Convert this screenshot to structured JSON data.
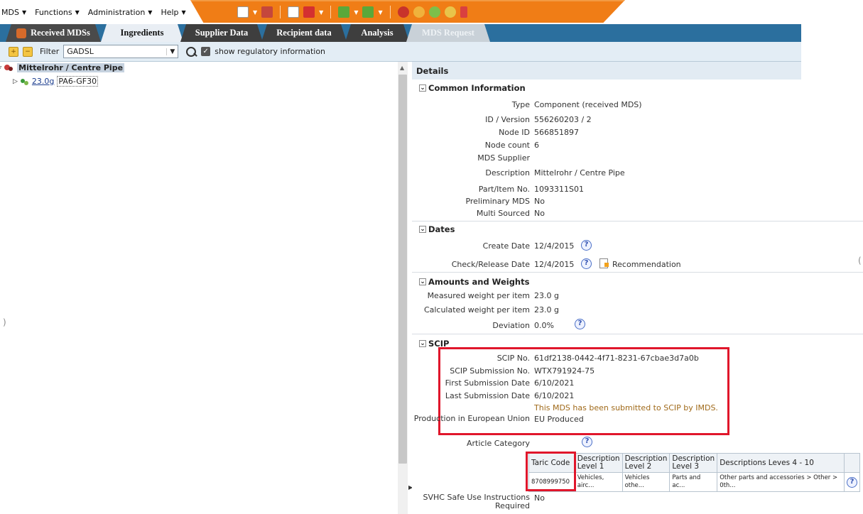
{
  "menubar": {
    "items": [
      {
        "label": "MDS"
      },
      {
        "label": "Functions"
      },
      {
        "label": "Administration"
      },
      {
        "label": "Help"
      }
    ],
    "toolbar_icons": [
      "new-document-icon",
      "save-icon",
      "edit-document-icon",
      "pdf-icon",
      "tree-green-icon",
      "tree-export-icon",
      "tree-import-icon",
      "red-cube-icon",
      "orange-shapes-icon",
      "green-shapes-icon",
      "yellow-shapes-icon",
      "flask-icon"
    ],
    "accent_color": "#f07d16"
  },
  "tabs": [
    {
      "label": "Received MDSs",
      "state": "normal"
    },
    {
      "label": "Ingredients",
      "state": "active"
    },
    {
      "label": "Supplier Data",
      "state": "normal"
    },
    {
      "label": "Recipient data",
      "state": "normal"
    },
    {
      "label": "Analysis",
      "state": "normal"
    },
    {
      "label": "MDS Request",
      "state": "disabled"
    }
  ],
  "filterbar": {
    "filter_label": "Filter",
    "filter_value": "GADSL",
    "show_reg_label": "show regulatory information",
    "show_reg_checked": true
  },
  "tree": {
    "root_label": "Mittelrohr / Centre Pipe",
    "child_weight": "23.0g",
    "child_label": "PA6-GF30"
  },
  "details": {
    "title": "Details",
    "common": {
      "heading": "Common Information",
      "fields": [
        {
          "label": "Type",
          "value": "Component (received MDS)"
        },
        {
          "label": "ID / Version",
          "value": "556260203 / 2"
        },
        {
          "label": "Node ID",
          "value": "566851897"
        },
        {
          "label": "Node count",
          "value": "6"
        },
        {
          "label": "MDS Supplier",
          "value": ""
        },
        {
          "label": "Description",
          "value": "Mittelrohr / Centre Pipe"
        },
        {
          "label": "Part/Item No.",
          "value": "1093311S01"
        },
        {
          "label": "Preliminary MDS",
          "value": "No"
        },
        {
          "label": "Multi Sourced",
          "value": "No"
        }
      ]
    },
    "dates": {
      "heading": "Dates",
      "create_label": "Create Date",
      "create_value": "12/4/2015",
      "check_label": "Check/Release Date",
      "check_value": "12/4/2015",
      "recommendation_label": "Recommendation"
    },
    "amounts": {
      "heading": "Amounts and Weights",
      "measured_label": "Measured weight per item",
      "measured_value": "23.0 g",
      "calculated_label": "Calculated weight per item",
      "calculated_value": "23.0 g",
      "deviation_label": "Deviation",
      "deviation_value": "0.0%"
    },
    "scip": {
      "heading": "SCIP",
      "scip_no_label": "SCIP No.",
      "scip_no_value": "61df2138-0442-4f71-8231-67cbae3d7a0b",
      "submission_no_label": "SCIP Submission No.",
      "submission_no_value": "WTX791924-75",
      "first_date_label": "First Submission Date",
      "first_date_value": "6/10/2021",
      "last_date_label": "Last Submission Date",
      "last_date_value": "6/10/2021",
      "note": "This MDS has been submitted to SCIP by IMDS.",
      "production_label": "Production in European Union",
      "production_value": "EU Produced",
      "article_category_label": "Article Category",
      "taric_headers": [
        "Taric Code",
        "Description Level 1",
        "Description Level 2",
        "Description Level 3",
        "Descriptions Leves 4 - 10"
      ],
      "taric_row": [
        "8708999750",
        "Vehicles, airc...",
        "Vehicles othe...",
        "Parts and ac...",
        "Other parts and accessories > Other > 0th..."
      ],
      "svhc_label": "SVHC Safe Use Instructions Required",
      "svhc_value": "No"
    },
    "highlight_color": "#e0162b"
  }
}
